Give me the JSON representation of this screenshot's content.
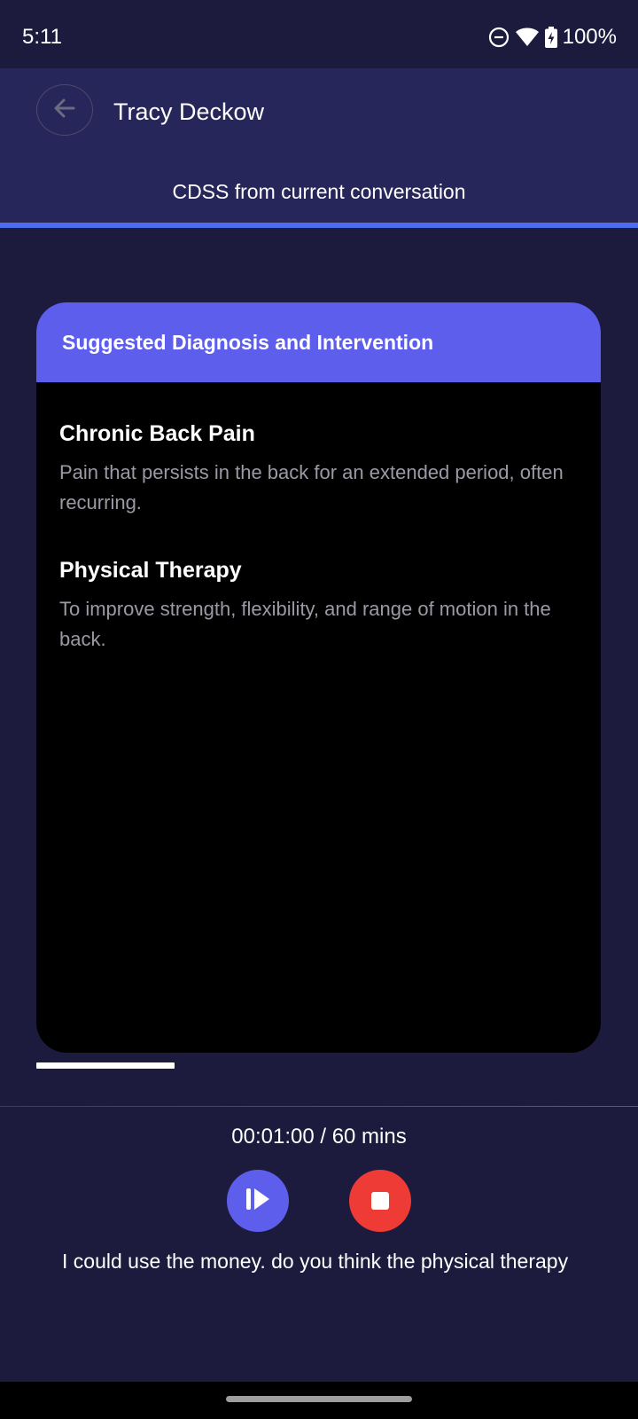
{
  "status_bar": {
    "time": "5:11",
    "battery": "100%",
    "icons": [
      "do-not-disturb-icon",
      "wifi-icon",
      "battery-charging-icon"
    ]
  },
  "header": {
    "title": "Tracy Deckow",
    "back_icon": "arrow-left-icon"
  },
  "tabs": {
    "active_label": "CDSS from current conversation"
  },
  "card": {
    "title": "Suggested Diagnosis and Intervention",
    "items": [
      {
        "title": "Chronic Back Pain",
        "description": "Pain that persists in the back for an extended period, often recurring."
      },
      {
        "title": "Physical Therapy",
        "description": "To improve strength, flexibility, and range of motion in the back."
      }
    ]
  },
  "recording": {
    "timer": "00:01:00 / 60 mins",
    "play_icon": "resume-icon",
    "stop_icon": "stop-icon",
    "transcript": "I could use the money. do you think the physical therapy"
  },
  "colors": {
    "background": "#1c1b3d",
    "header": "#27265a",
    "accent": "#5e5eec",
    "tab_indicator": "#4f6cf0",
    "stop": "#ee3b35",
    "card_body": "#000000"
  }
}
